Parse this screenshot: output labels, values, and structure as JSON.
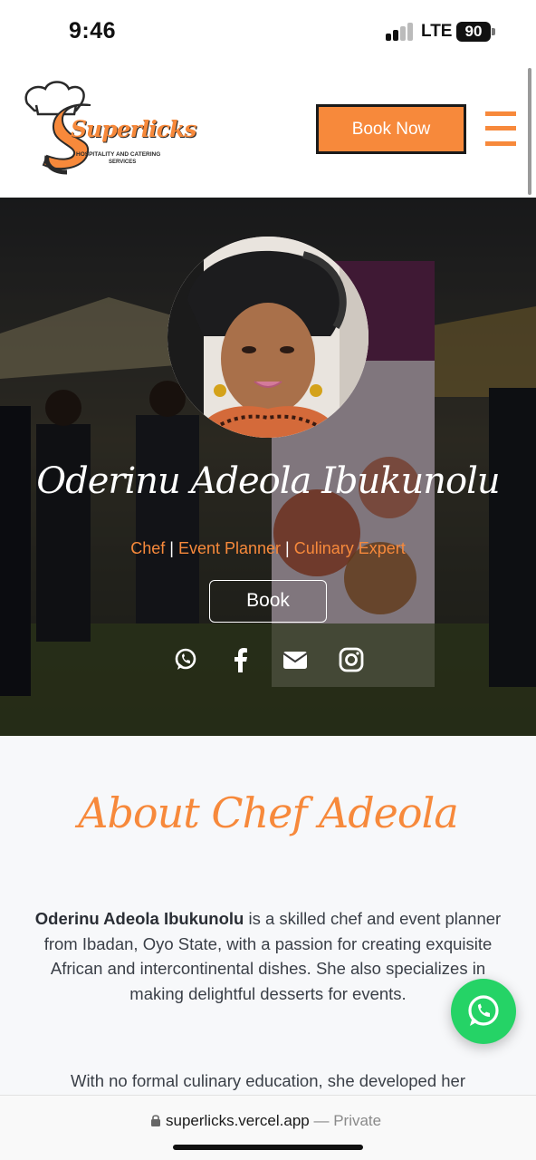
{
  "status_bar": {
    "time": "9:46",
    "network": "LTE",
    "battery": "90"
  },
  "header": {
    "logo_text": "Superlicks",
    "logo_subtext": "HOSPITALITY AND CATERING",
    "logo_subtext2": "SERVICES",
    "book_now_label": "Book Now",
    "menu_icon": "hamburger-menu-icon",
    "accent_color": "#f7893b"
  },
  "hero": {
    "name": "Oderinu Adeola Ibukunolu",
    "roles": [
      "Chef",
      "Event Planner",
      "Culinary Expert"
    ],
    "separator": "|",
    "book_label": "Book",
    "socials": [
      "whatsapp-icon",
      "facebook-icon",
      "envelope-icon",
      "instagram-icon"
    ]
  },
  "about": {
    "title": "About Chef Adeola",
    "p1_name": "Oderinu Adeola Ibukunolu",
    "p1_rest": " is a skilled chef and event planner from Ibadan, Oyo State, with a passion for creating exquisite African and intercontinental dishes. She also specializes in making delightful desserts for events.",
    "p2": "With no formal culinary education, she developed her"
  },
  "floating": {
    "whatsapp_icon": "whatsapp-icon",
    "color": "#25d366"
  },
  "browser": {
    "url": "superlicks.vercel.app",
    "suffix": " — Private"
  }
}
